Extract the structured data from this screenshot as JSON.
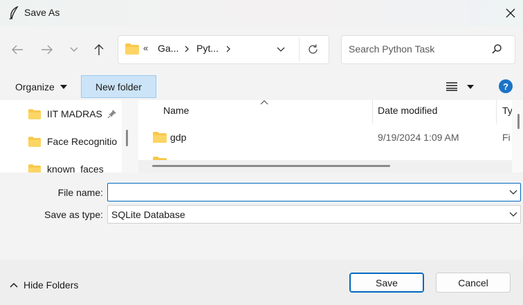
{
  "window": {
    "title": "Save As",
    "icon": "feather-icon",
    "close_icon": "close-icon"
  },
  "navigation": {
    "back_icon": "back-arrow-icon",
    "forward_icon": "forward-arrow-icon",
    "recent_icon": "chevron-down-icon",
    "up_icon": "up-arrow-icon",
    "address": {
      "overflow_marker": "«",
      "segments": [
        "Ga...",
        "Pyt..."
      ],
      "refresh_icon": "refresh-icon"
    },
    "search_placeholder": "Search Python Task"
  },
  "commands": {
    "organize_label": "Organize",
    "new_folder_label": "New folder",
    "view_icon": "view-list-icon",
    "help_label": "?"
  },
  "nav_pane": {
    "items": [
      {
        "label": "IIT MADRAS",
        "pinned": true
      },
      {
        "label": "Face Recognitio",
        "pinned": false
      },
      {
        "label": "known_faces",
        "pinned": false
      }
    ]
  },
  "file_list": {
    "columns": [
      "Name",
      "Date modified",
      "Ty"
    ],
    "rows": [
      {
        "name": "gdp",
        "date_modified": "9/19/2024 1:09 AM",
        "type": "Fi"
      }
    ]
  },
  "form": {
    "file_name_label": "File name:",
    "file_name_value": "",
    "save_as_type_label": "Save as type:",
    "save_as_type_value": "SQLite Database"
  },
  "footer": {
    "hide_folders_label": "Hide Folders",
    "save_label": "Save",
    "cancel_label": "Cancel"
  },
  "colors": {
    "accent": "#0067c0",
    "folder": "#f8c84a",
    "new_folder_bg": "#cce4f7",
    "help_bg": "#1a73c8"
  }
}
